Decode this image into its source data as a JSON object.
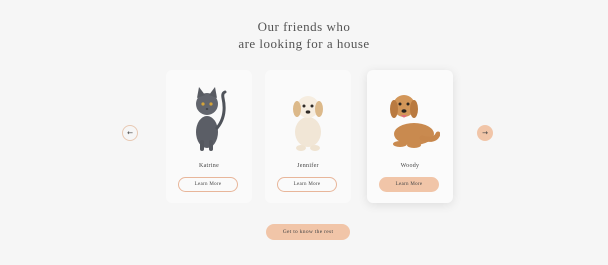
{
  "section": {
    "title_line1": "Our friends who",
    "title_line2": "are looking for a house",
    "prev_label": "←",
    "next_label": "→"
  },
  "pets": [
    {
      "name": "Katrine",
      "button": "Learn More",
      "icon": "cat-icon"
    },
    {
      "name": "Jennifer",
      "button": "Learn More",
      "icon": "puppy-icon"
    },
    {
      "name": "Woody",
      "button": "Learn More",
      "icon": "dog-icon"
    }
  ],
  "cta": {
    "label": "Get to know the rest"
  },
  "colors": {
    "accent": "#f1c5a8",
    "background": "#f6f6f6",
    "text": "#545454"
  }
}
